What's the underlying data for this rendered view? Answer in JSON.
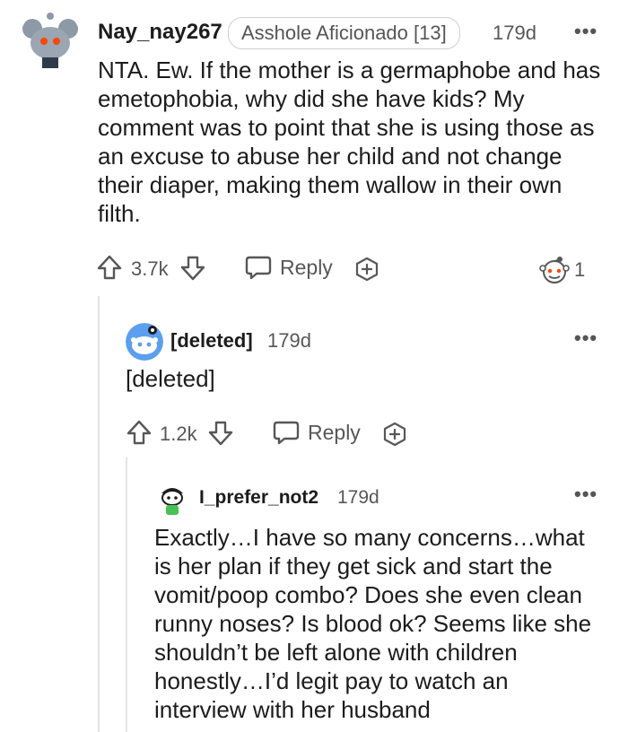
{
  "comments": [
    {
      "username": "Nay_nay267",
      "flair": "Asshole Aficionado [13]",
      "time": "179d",
      "more": "•••",
      "body": "NTA. Ew. If the mother is a germaphobe and has emetophobia, why did she have kids? My comment was to point that she is using those as an excuse to abuse her child and not change their diaper, making them wallow in their own filth.",
      "votes": "3.7k",
      "reply_label": "Reply",
      "award_count": "1",
      "avatar_icon": "snoo-koala-avatar-icon"
    },
    {
      "username": "[deleted]",
      "time": "179d",
      "more": "•••",
      "body": "[deleted]",
      "votes": "1.2k",
      "reply_label": "Reply",
      "avatar_icon": "snoo-default-avatar-icon"
    },
    {
      "username": "I_prefer_not2",
      "time": "179d",
      "more": "•••",
      "body": "Exactly…I have so many concerns…what is her plan if they get sick and start the vomit/poop combo? Does she even clean runny noses? Is blood ok? Seems like she shouldn’t be left alone with children honestly…I’d legit pay to watch an interview with her husband",
      "avatar_icon": "snoo-custom-avatar-icon"
    }
  ],
  "colors": {
    "text": "#1c1c1c",
    "meta": "#575757",
    "thread_line": "#e5e5e5",
    "snoo_blue": "#5a9ff0",
    "snoo_orange": "#ff4500"
  }
}
